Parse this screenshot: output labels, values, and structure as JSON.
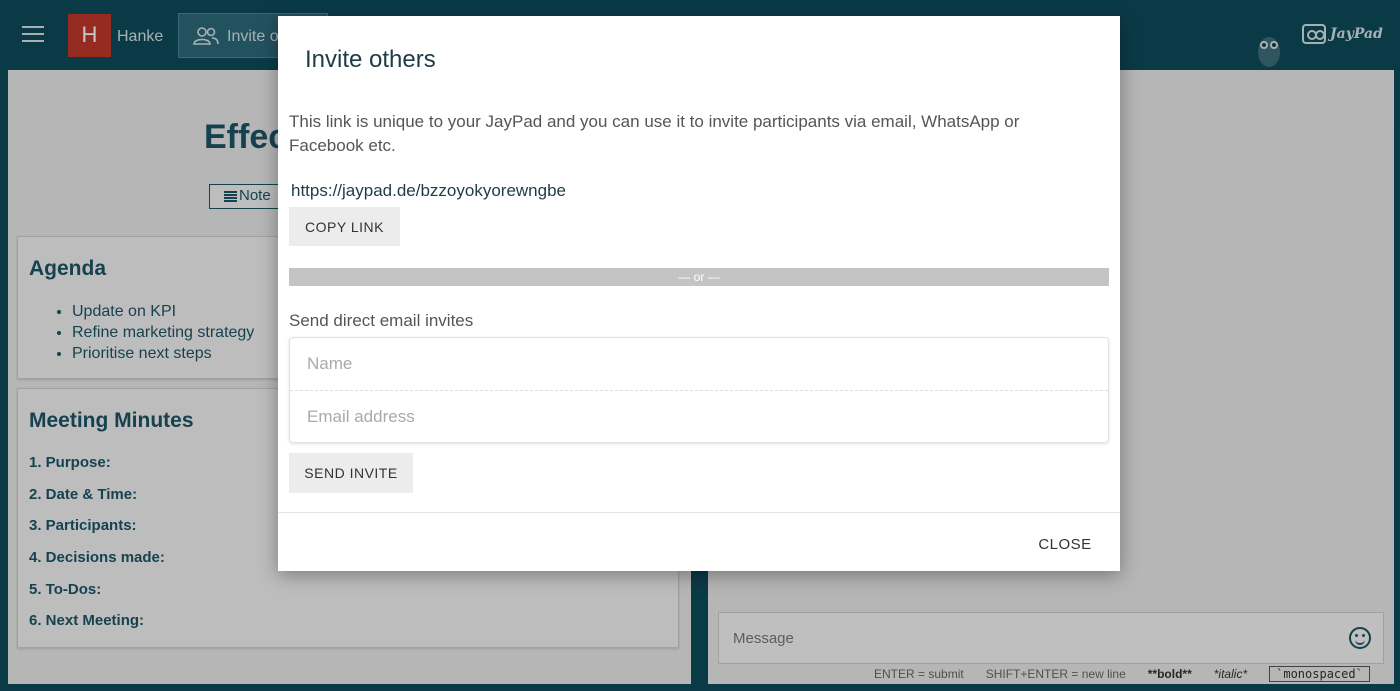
{
  "topbar": {
    "user_initial": "H",
    "user_name": "Hanke",
    "invite_label": "Invite others",
    "logo_text": "JayPad"
  },
  "document": {
    "title": "Effective Meeting",
    "note_button": "Note",
    "agenda": {
      "heading": "Agenda",
      "items": [
        "Update on KPI",
        "Refine marketing strategy",
        "Prioritise next steps"
      ]
    },
    "minutes": {
      "heading": "Meeting Minutes",
      "items": [
        "1. Purpose:",
        "2. Date & Time:",
        "3. Participants:",
        "4. Decisions made:",
        "5. To-Dos:",
        "6. Next Meeting:"
      ]
    }
  },
  "chat": {
    "message_placeholder": "Message",
    "hints": {
      "enter": "ENTER = submit",
      "shift_enter": "SHIFT+ENTER = new line",
      "bold": "**bold**",
      "italic": "*italic*",
      "mono": "`monospaced`"
    }
  },
  "modal": {
    "title": "Invite others",
    "description": "This link is unique to your JayPad and you can use it to invite participants via email, WhatsApp or Facebook etc.",
    "link": "https://jaypad.de/bzzoyokyorewngbe",
    "copy_label": "COPY LINK",
    "divider": "— or —",
    "email_heading": "Send direct email invites",
    "name_placeholder": "Name",
    "email_placeholder": "Email address",
    "send_label": "SEND INVITE",
    "close_label": "CLOSE"
  }
}
